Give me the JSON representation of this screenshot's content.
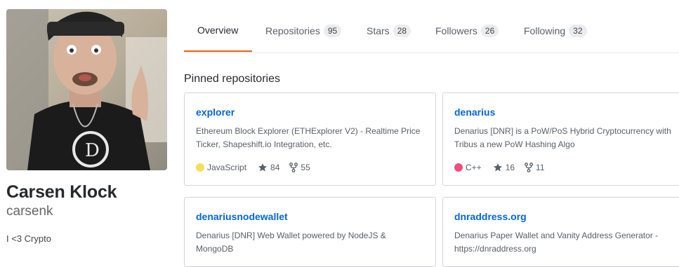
{
  "profile": {
    "fullname": "Carsen Klock",
    "username": "carsenk",
    "bio": "I <3 Crypto"
  },
  "tabs": [
    {
      "label": "Overview",
      "count": null,
      "selected": true
    },
    {
      "label": "Repositories",
      "count": "95",
      "selected": false
    },
    {
      "label": "Stars",
      "count": "28",
      "selected": false
    },
    {
      "label": "Followers",
      "count": "26",
      "selected": false
    },
    {
      "label": "Following",
      "count": "32",
      "selected": false
    }
  ],
  "pinned": {
    "title": "Pinned repositories",
    "repos": [
      {
        "name": "explorer",
        "description": "Ethereum Block Explorer (ETHExplorer V2) - Realtime Price Ticker, Shapeshift.io Integration, etc.",
        "language": "JavaScript",
        "language_color": "#f1e05a",
        "stars": "84",
        "forks": "55"
      },
      {
        "name": "denarius",
        "description": "Denarius [DNR] is a PoW/PoS Hybrid Cryptocurrency with Tribus a new PoW Hashing Algo",
        "language": "C++",
        "language_color": "#f34b7d",
        "stars": "16",
        "forks": "11"
      },
      {
        "name": "denariusnodewallet",
        "description": "Denarius [DNR] Web Wallet powered by NodeJS & MongoDB"
      },
      {
        "name": "dnraddress.org",
        "description": "Denarius Paper Wallet and Vanity Address Generator - https://dnraddress.org"
      }
    ]
  },
  "colors": {
    "accent_underline": "#e36209",
    "link": "#0366d6"
  }
}
